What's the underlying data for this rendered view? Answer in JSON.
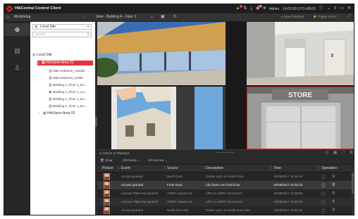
{
  "app": {
    "title": "HikCentral Control Client",
    "user": "Admin",
    "time": "14:03:00 UTC+08:00",
    "alarm_badge": "1",
    "notif_badge": "99"
  },
  "tabbar": {
    "module": "Monitoring",
    "view_title": "View - Building A - Floor 2",
    "map_disabled": "Map Disabled",
    "trigger_event": "Trigger Event"
  },
  "tree": {
    "site_select": "Local Site",
    "search_placeholder": "Search",
    "root": "Local Site",
    "area1": "HikVision Area 01",
    "cameras": [
      "Main entrance_outside",
      "Main entrance_inside",
      "Building A_Floor 1_Do...",
      "Building A_Floor 1_Ca...",
      "Building A_Floor 1_Do...",
      "Building A_Floor 1_Do..."
    ],
    "area2": "HikVision Area 02"
  },
  "events": {
    "switch_playback": "Switch to Playback",
    "clear": "Clear",
    "all_events": "All Events",
    "all_sources": "All Sources",
    "columns": {
      "picture": "Picture",
      "event": "Event",
      "source": "Source",
      "description": "Description",
      "time": "Time",
      "operation": "Operation"
    },
    "rows": [
      {
        "event": "Access granted",
        "source": "North Door",
        "description": "Center Lynn on North Door",
        "time": "10/29/2017 15:16:20"
      },
      {
        "event": "Access granted",
        "source": "Front Door",
        "description": "Lily Owen on Front Door",
        "time": "10/29/2017 15:32:23"
      },
      {
        "event": "License Plate Recognized",
        "source": "ANPR Camera 01",
        "description": "LPR on ANPR Camera 01",
        "time": "10/29/2017 15:28:59"
      },
      {
        "event": "License Plate Recognized",
        "source": "ANPR Camera 02",
        "description": "LPR on ANPR Camera 02",
        "time": "10/29/2017 15:46:09"
      },
      {
        "event": "Access granted",
        "source": "North Door 001",
        "description": "Center Lynn on North Door 001",
        "time": "10/29/2017 15:51:53"
      }
    ]
  },
  "colors": {
    "accent": "#e8333a",
    "window_bg": "#2b2b2b",
    "alarm": "#e0a020"
  }
}
